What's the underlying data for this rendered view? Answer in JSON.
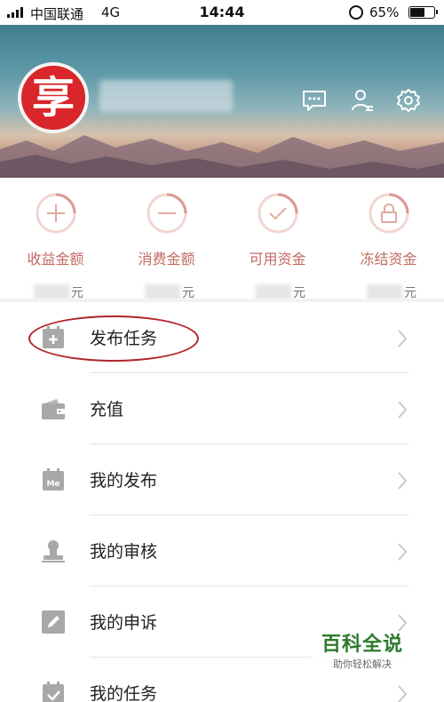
{
  "status_bar": {
    "carrier": "中国联通",
    "network": "4G",
    "time": "14:44",
    "battery_percent": "65%",
    "battery_level": 0.65
  },
  "header": {
    "avatar_text": "享",
    "icons": [
      "message-icon",
      "user-profile-icon",
      "settings-gear-icon"
    ]
  },
  "summary": [
    {
      "label": "收益金额",
      "unit": "元",
      "icon": "plus-circle-icon"
    },
    {
      "label": "消费金额",
      "unit": "元",
      "icon": "minus-circle-icon"
    },
    {
      "label": "可用资金",
      "unit": "元",
      "icon": "check-circle-icon"
    },
    {
      "label": "冻结资金",
      "unit": "元",
      "icon": "lock-circle-icon"
    }
  ],
  "menu": [
    {
      "label": "发布任务",
      "icon": "add-calendar-icon"
    },
    {
      "label": "充值",
      "icon": "wallet-icon"
    },
    {
      "label": "我的发布",
      "icon": "me-calendar-icon",
      "icon_text": "Me"
    },
    {
      "label": "我的审核",
      "icon": "stamp-icon"
    },
    {
      "label": "我的申诉",
      "icon": "edit-icon"
    },
    {
      "label": "我的任务",
      "icon": "task-check-icon"
    }
  ],
  "watermark": {
    "title": "百科全说",
    "subtitle": "助你轻松解决"
  },
  "colors": {
    "accent": "#c26a62",
    "avatar": "#d8262b",
    "highlight": "#b2232a",
    "icon_gray": "#a8a8a8"
  }
}
